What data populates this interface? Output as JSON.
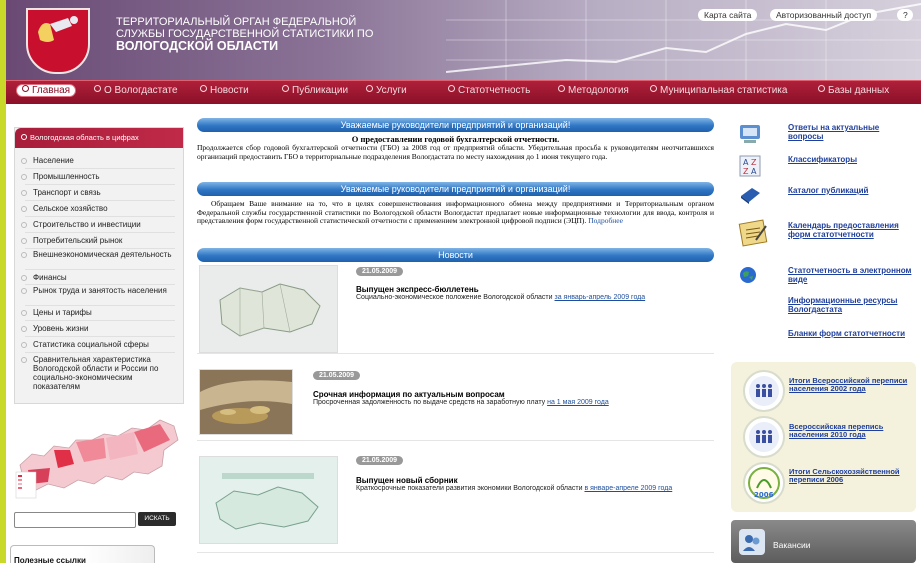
{
  "colors": {
    "accent": "#b0203a",
    "nav_bg": "#8a1028",
    "link": "#1f3f9c",
    "bar_blue": "#2f76c4",
    "outer_bg": "#c9d92a"
  },
  "header": {
    "title_lines": [
      "ТЕРРИТОРИАЛЬНЫЙ ОРГАН ФЕДЕРАЛЬНОЙ",
      "СЛУЖБЫ ГОСУДАРСТВЕННОЙ СТАТИСТИКИ ПО",
      "ВОЛОГОДСКОЙ ОБЛАСТИ"
    ],
    "sitemap_label": "Карта сайта",
    "auth_label": "Авторизованный доступ",
    "help_label": "?"
  },
  "nav": {
    "items": [
      "Главная",
      "О Вологдастате",
      "Новости",
      "Публикации",
      "Услуги",
      "Статотчетность",
      "Методология",
      "Муниципальная статистика",
      "Базы данных"
    ]
  },
  "sidebar": {
    "title": "Вологодская область в цифрах",
    "items": [
      "Население",
      "Промышленность",
      "Транспорт и связь",
      "Сельское хозяйство",
      "Строительство и инвестиции",
      "Потребительский рынок",
      "Внешнеэкономическая деятельность",
      "Финансы",
      "Рынок труда и занятость населения",
      "Цены и тарифы",
      "Уровень жизни",
      "Статистика социальной сферы",
      "Сравнительная характеристика Вологодской области и России по социально-экономическим показателям"
    ],
    "search_button": "ИСКАТЬ",
    "search_value": "",
    "useful_links": "Полезные ссылки"
  },
  "notices": [
    {
      "bar": "Уважаемые руководители предприятий и организаций!",
      "title": "О предоставлении годовой бухгалтерской отчетности.",
      "text": "Продолжается сбор годовой бухгалтерской отчетности (ГБО) за 2008 год от предприятий области. Убедительная просьба к руководителям неотчитавшихся организаций предоставить ГБО в территориальные подразделения Вологдастата по месту нахождения до 1 июня текущего года."
    },
    {
      "bar": "Уважаемые руководители предприятий и организаций!",
      "text": "Обращаем Ваше внимание на то, что в целях совершенствования информационного обмена между предприятиями и Территориальным органом Федеральной службы государственной статистики по Вологодской области Вологдастат предлагает новые информационные технологии для ввода, контроля и представления форм государственной статистической отчетности с применением электронной цифровой подписи (ЭЦП).",
      "more": "Подробнее"
    }
  ],
  "news": {
    "bar": "Новости",
    "items": [
      {
        "date": "21.05.2009",
        "title": "Выпущен экспресс-бюллетень",
        "text": "Социально-экономическое положение Вологодской области",
        "link": "за январь-апрель 2009 года"
      },
      {
        "date": "21.05.2009",
        "title": "Срочная информация по актуальным вопросам",
        "text": "Просроченная задолженность по выдаче средств на заработную плату",
        "link": "на 1 мая 2009 года"
      },
      {
        "date": "21.05.2009",
        "title": "Выпущен новый сборник",
        "text": "Краткосрочные показатели развития экономики Вологодской области",
        "link": "в январе-апреле 2009 года"
      }
    ]
  },
  "right": {
    "links": [
      "Ответы на актуальные вопросы",
      "Классификаторы",
      "Каталог публикаций",
      "Календарь предоставления форм статотчетности",
      "Статотчетность в электронном виде",
      "Информационные ресурсы Вологдастата",
      "Бланки форм статотчетности"
    ],
    "census": [
      "Итоги Всероссийской переписи населения 2002 года",
      "Всероссийская перепись населения 2010 года",
      "Итоги Сельскохозяйственной переписи 2006"
    ],
    "census_year": "2006",
    "vacancy": "Вакансии"
  }
}
